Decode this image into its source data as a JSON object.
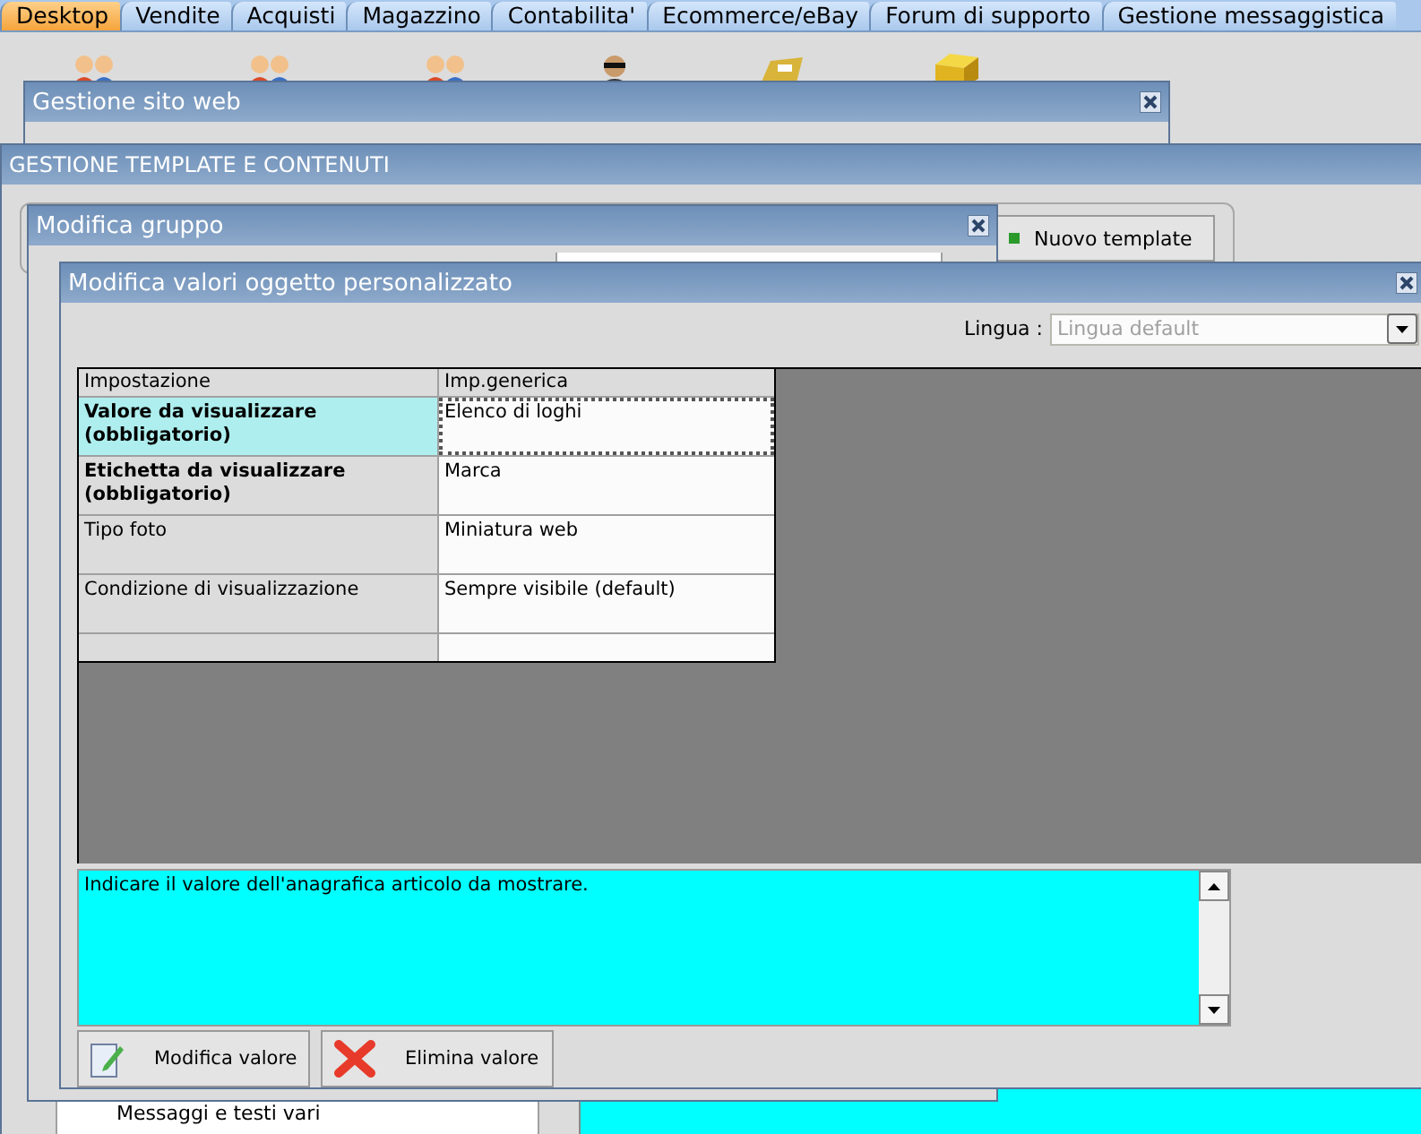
{
  "tabs": [
    {
      "label": "Desktop",
      "selected": true
    },
    {
      "label": "Vendite",
      "selected": false
    },
    {
      "label": "Acquisti",
      "selected": false
    },
    {
      "label": "Magazzino",
      "selected": false
    },
    {
      "label": "Contabilita'",
      "selected": false
    },
    {
      "label": "Ecommerce/eBay",
      "selected": false
    },
    {
      "label": "Forum di supporto",
      "selected": false
    },
    {
      "label": "Gestione messaggistica",
      "selected": false
    }
  ],
  "site_window": {
    "title": "Gestione sito web"
  },
  "template_window": {
    "title": "GESTIONE TEMPLATE E CONTENUTI",
    "new_template_button": "Nuovo template",
    "tree_item": "Messaggi e testi vari"
  },
  "group_window": {
    "title": "Modifica gruppo"
  },
  "dialog": {
    "title": "Modifica valori oggetto personalizzato",
    "language": {
      "label": "Lingua :",
      "value": "Lingua default",
      "disabled": true
    },
    "table": {
      "columns": [
        "Impostazione",
        "Imp.generica"
      ],
      "rows": [
        {
          "setting": "Valore da visualizzare (obbligatorio)",
          "value": "Elenco di loghi",
          "required": true,
          "selected": true
        },
        {
          "setting": "Etichetta da visualizzare (obbligatorio)",
          "value": "Marca",
          "required": true,
          "selected": false
        },
        {
          "setting": "Tipo foto",
          "value": "Miniatura web",
          "required": false,
          "selected": false
        },
        {
          "setting": "Condizione di visualizzazione",
          "value": "Sempre visibile (default)",
          "required": false,
          "selected": false
        }
      ]
    },
    "description": "Indicare il valore dell'anagrafica articolo da mostrare.",
    "buttons": [
      {
        "label": "Modifica valore",
        "kind": "edit"
      },
      {
        "label": "Elimina valore",
        "kind": "delete"
      }
    ]
  }
}
